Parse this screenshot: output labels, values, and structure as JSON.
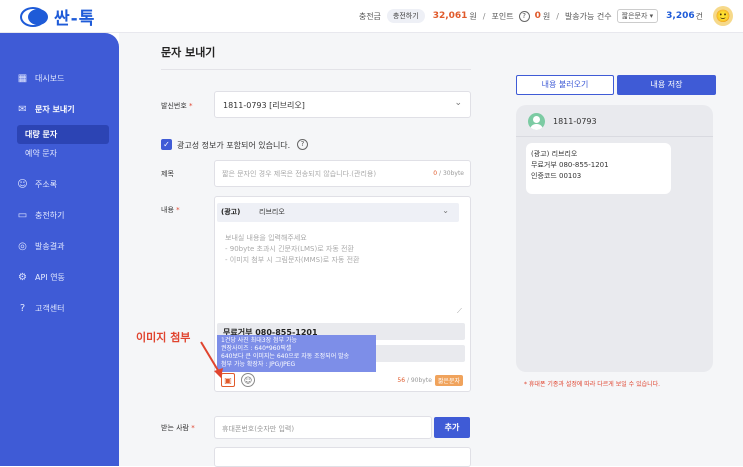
{
  "app": {
    "logo_text": "싼-톡"
  },
  "topbar": {
    "charge_label": "충전금",
    "charge_button": "충전하기",
    "charge_amount": "32,061",
    "won1": "원",
    "point_label": "포인트",
    "point_amount": "0",
    "won2": "원",
    "send_count_label": "발송가능 건수",
    "send_type": "짧은문자",
    "send_count": "3,206",
    "count_unit": "건"
  },
  "sidebar": {
    "items": [
      {
        "label": "대시보드",
        "icon": "dashboard-icon"
      },
      {
        "label": "문자 보내기",
        "icon": "message-icon"
      },
      {
        "label": "주소록",
        "icon": "contacts-icon"
      },
      {
        "label": "충전하기",
        "icon": "card-icon"
      },
      {
        "label": "발송결과",
        "icon": "result-icon"
      },
      {
        "label": "API 연동",
        "icon": "api-icon"
      },
      {
        "label": "고객센터",
        "icon": "help-icon"
      }
    ],
    "sub_items": [
      {
        "label": "대량 문자"
      },
      {
        "label": "예약 문자"
      }
    ]
  },
  "main": {
    "title": "문자 보내기",
    "sender": {
      "label": "발신번호",
      "value": "1811-0793 [리브리오]"
    },
    "ad_check_label": "광고성 정보가 포함되어 있습니다.",
    "subject": {
      "label": "제목",
      "placeholder": "짧은 문자인 경우 제목은 전송되지 않습니다.(관리용)",
      "count": "0",
      "limit": "/ 30byte"
    },
    "content": {
      "label": "내용",
      "ad_tag": "(광고)",
      "ad_name": "리브리오",
      "placeholder_lines": [
        "보내실 내용을 입력해주세요",
        "- 90byte 초과시 긴문자(LMS)로 자동 전환",
        "- 이미지 첨부 시 그림문자(MMS)로 자동 전환"
      ],
      "free_reject": "무료거부 080-855-1201",
      "count": "56",
      "limit": "/ 90byte",
      "type_badge": "짧은문자"
    },
    "tooltip_lines": [
      "1건당 사진 최대3장 첨부 가능",
      "권장사이즈 : 640*960픽셀",
      "640보다 큰 이미지는 640으로 자동 조정되어 발송",
      "첨부 가능 확장자 : JPG/JPEG"
    ],
    "callout": "이미지 첨부",
    "receiver": {
      "label": "받는 사람",
      "placeholder": "휴대폰번호(숫자만 입력)",
      "add_button": "추가"
    }
  },
  "preview": {
    "load_button": "내용 불러오기",
    "save_button": "내용 저장",
    "phone_number": "1811-0793",
    "bubble_lines": [
      "(광고) 리브리오",
      "무료거부 080-855-1201",
      "인증코드 00103"
    ],
    "footnote": "* 휴대폰 기종과 설정에 따라 다르게 보일 수 있습니다."
  }
}
